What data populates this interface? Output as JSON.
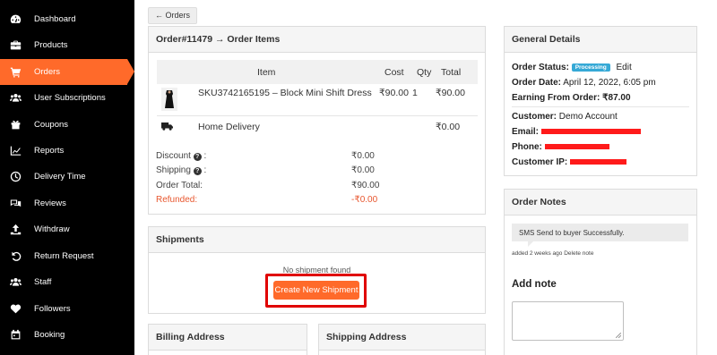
{
  "sidebar": {
    "items": [
      {
        "label": "Dashboard",
        "icon": "dashboard-icon"
      },
      {
        "label": "Products",
        "icon": "briefcase-icon"
      },
      {
        "label": "Orders",
        "icon": "cart-icon",
        "active": true
      },
      {
        "label": "User Subscriptions",
        "icon": "users-icon"
      },
      {
        "label": "Coupons",
        "icon": "gift-icon"
      },
      {
        "label": "Reports",
        "icon": "chart-icon"
      },
      {
        "label": "Delivery Time",
        "icon": "clock-icon"
      },
      {
        "label": "Reviews",
        "icon": "comments-icon"
      },
      {
        "label": "Withdraw",
        "icon": "upload-icon"
      },
      {
        "label": "Return Request",
        "icon": "undo-icon"
      },
      {
        "label": "Staff",
        "icon": "users-icon"
      },
      {
        "label": "Followers",
        "icon": "heart-icon"
      },
      {
        "label": "Booking",
        "icon": "calendar-icon"
      }
    ],
    "accent": "#ff6a2a"
  },
  "breadcrumb": {
    "label": "← Orders"
  },
  "order_items": {
    "title": "Order#11479 → Order Items",
    "columns": [
      "Item",
      "Cost",
      "Qty",
      "Total"
    ],
    "rows": [
      {
        "name": "SKU3742165195 – Block Mini Shift Dress",
        "cost": "₹90.00",
        "qty": "1",
        "total": "₹90.00"
      }
    ],
    "shipping": {
      "label": "Home Delivery",
      "total": "₹0.00"
    },
    "summary": {
      "discount_label": "Discount",
      "discount_value": "₹0.00",
      "shipping_label": "Shipping",
      "shipping_value": "₹0.00",
      "total_label": "Order Total:",
      "total_value": "₹90.00",
      "refunded_label": "Refunded:",
      "refunded_value": "-₹0.00"
    }
  },
  "shipments": {
    "title": "Shipments",
    "empty_text": "No shipment found",
    "create_button": "Create New Shipment"
  },
  "billing": {
    "title": "Billing Address"
  },
  "shipping_address": {
    "title": "Shipping Address"
  },
  "general_details": {
    "title": "General Details",
    "status_label": "Order Status:",
    "status_badge": "Processing",
    "edit_link": "Edit",
    "date_label": "Order Date:",
    "date_value": "April 12, 2022, 6:05 pm",
    "earning_label": "Earning From Order:",
    "earning_value": "₹87.00",
    "customer_label": "Customer:",
    "customer_value": "Demo Account",
    "email_label": "Email:",
    "phone_label": "Phone:",
    "ip_label": "Customer IP:"
  },
  "order_notes": {
    "title": "Order Notes",
    "note_text": "SMS Send to buyer Successfully.",
    "note_meta": "added 2 weeks ago",
    "delete_link": "Delete note",
    "add_note_title": "Add note"
  }
}
